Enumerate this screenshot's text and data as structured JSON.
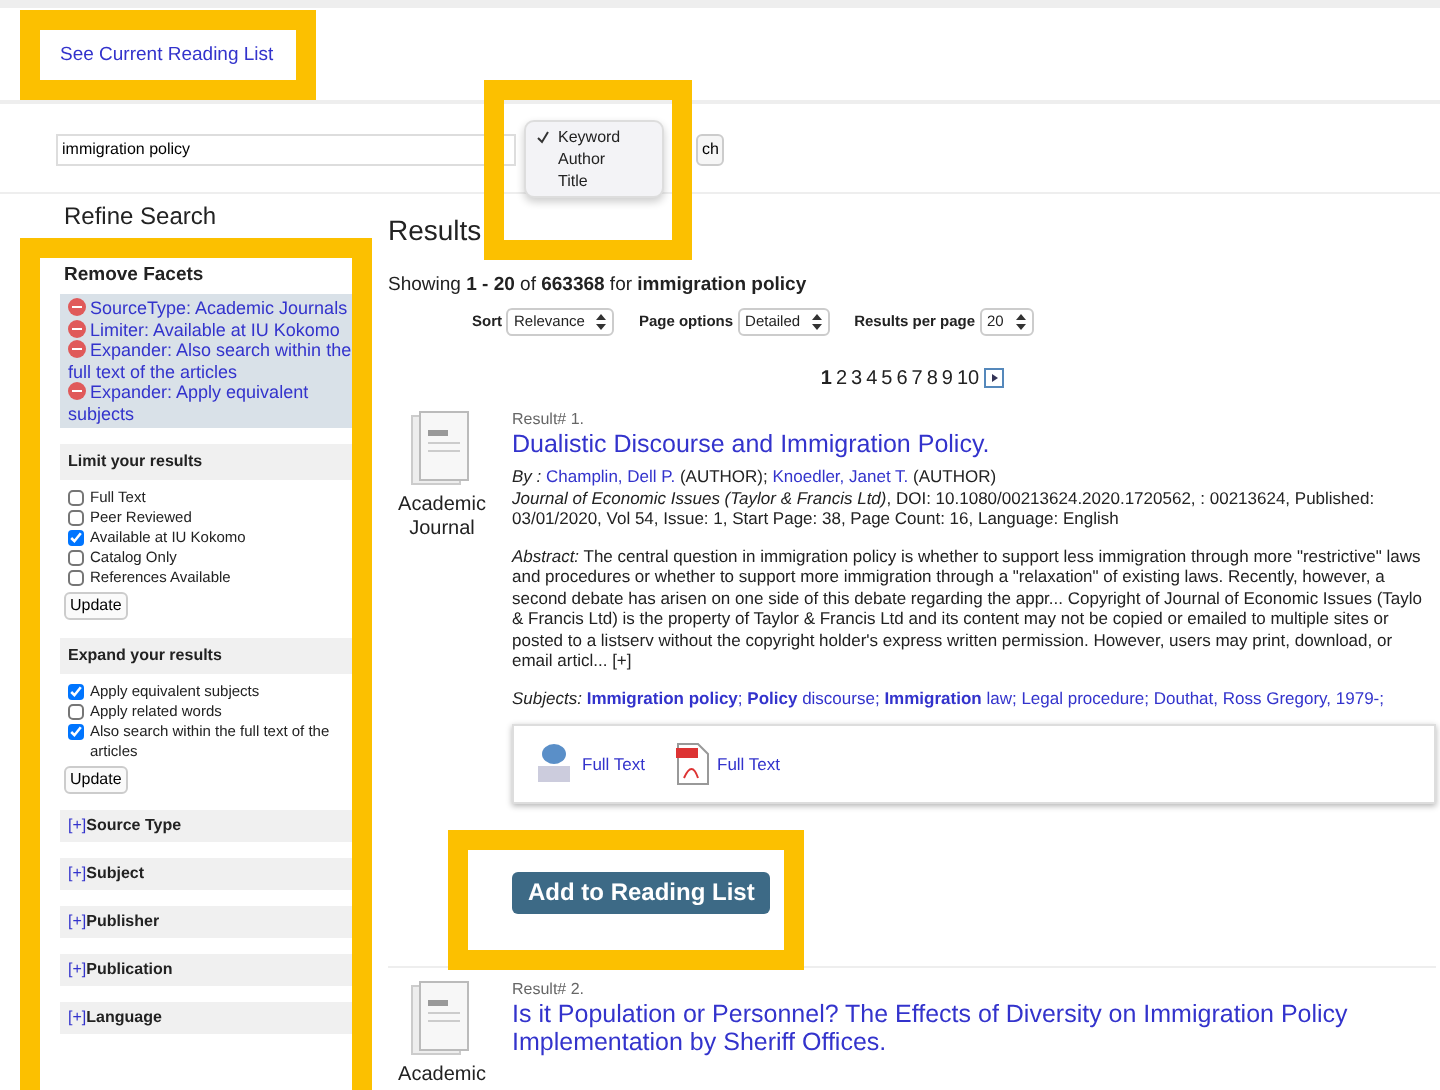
{
  "top_link": "See Current Reading List",
  "search": {
    "value": "immigration policy",
    "button_label": "ch"
  },
  "search_type_menu": [
    {
      "label": "Keyword",
      "selected": true
    },
    {
      "label": "Author",
      "selected": false
    },
    {
      "label": "Title",
      "selected": false
    }
  ],
  "sidebar": {
    "title": "Refine Search",
    "remove_facets": {
      "heading": "Remove Facets",
      "items": [
        "SourceType: Academic Journals",
        "Limiter: Available at IU Kokomo",
        "Expander: Also search within the full text of the articles",
        "Expander: Apply equivalent subjects"
      ]
    },
    "limit": {
      "heading": "Limit your results",
      "options": [
        {
          "label": "Full Text",
          "checked": false
        },
        {
          "label": "Peer Reviewed",
          "checked": false
        },
        {
          "label": "Available at IU Kokomo",
          "checked": true
        },
        {
          "label": "Catalog Only",
          "checked": false
        },
        {
          "label": "References Available",
          "checked": false
        }
      ],
      "button": "Update"
    },
    "expand": {
      "heading": "Expand your results",
      "options": [
        {
          "label": "Apply equivalent subjects",
          "checked": true
        },
        {
          "label": "Apply related words",
          "checked": false
        },
        {
          "label": "Also search within the full text of the articles",
          "checked": true
        }
      ],
      "button": "Update"
    },
    "facet_groups": [
      {
        "toggle": "[+]",
        "label": "Source Type"
      },
      {
        "toggle": "[+]",
        "label": "Subject"
      },
      {
        "toggle": "[+]",
        "label": "Publisher"
      },
      {
        "toggle": "[+]",
        "label": "Publication"
      },
      {
        "toggle": "[+]",
        "label": "Language"
      }
    ]
  },
  "results": {
    "heading": "Results",
    "summary": "Showing **1 - 20** of **663368** for **immigration policy**",
    "controls": [
      {
        "label": "Sort",
        "value": "Relevance"
      },
      {
        "label": "Page options",
        "value": "Detailed"
      },
      {
        "label": "Results per page",
        "value": "20"
      }
    ],
    "pages": [
      {
        "label": "1",
        "selected": true
      },
      {
        "label": "2",
        "selected": false
      },
      {
        "label": "3",
        "selected": false
      },
      {
        "label": "4",
        "selected": false
      },
      {
        "label": "5",
        "selected": false
      },
      {
        "label": "6",
        "selected": false
      },
      {
        "label": "7",
        "selected": false
      },
      {
        "label": "8",
        "selected": false
      },
      {
        "label": "9",
        "selected": false
      },
      {
        "label": "10",
        "selected": false
      }
    ],
    "items": [
      {
        "number": "Result# 1.",
        "title": "Dualistic Discourse and Immigration Policy.",
        "type_label": "Academic Journal",
        "by_label": "By :",
        "authors": [
          {
            "name": "Champlin, Dell P.",
            "role": "(AUTHOR);"
          },
          {
            "name": "Knoedler, Janet T.",
            "role": "(AUTHOR)"
          }
        ],
        "source": "*Journal of Economic Issues (Taylor & Francis Ltd)*, DOI: 10.1080/00213624.2020.1720562, : 00213624, Published: 03/01/2020, Vol 54, Issue: 1, Start Page: 38, Page Count: 16, Language: English",
        "abstract": "*Abstract:* The central question in immigration policy is whether to support less immigration through more \"restrictive\" laws and procedures or whether to support more immigration through a \"relaxation\" of existing laws. Recently, however, a second debate has arisen on one side of this debate regarding the appr... Copyright of Journal of Economic Issues (Taylo & Francis Ltd) is the property of Taylor & Francis Ltd and its content may not be copied or emailed to multiple sites or posted to a listserv without the copyright holder's express written permission. However, users may print, download, or email articl... [+]",
        "subjects_label": "Subjects:",
        "subjects": [
          "**Immigration policy**;",
          "**Policy** discourse;",
          "**Immigration** law;",
          "Legal procedure;",
          "Douthat, Ross Gregory, 1979-;"
        ],
        "links": [
          {
            "kind": "html",
            "label": "Full Text"
          },
          {
            "kind": "pdf",
            "label": "Full Text"
          }
        ],
        "add_button": "Add to Reading List"
      },
      {
        "number": "Result# 2.",
        "title": "Is it Population or Personnel? The Effects of Diversity on Immigration Policy Implementation by Sheriff Offices.",
        "type_label": "Academic"
      }
    ]
  }
}
